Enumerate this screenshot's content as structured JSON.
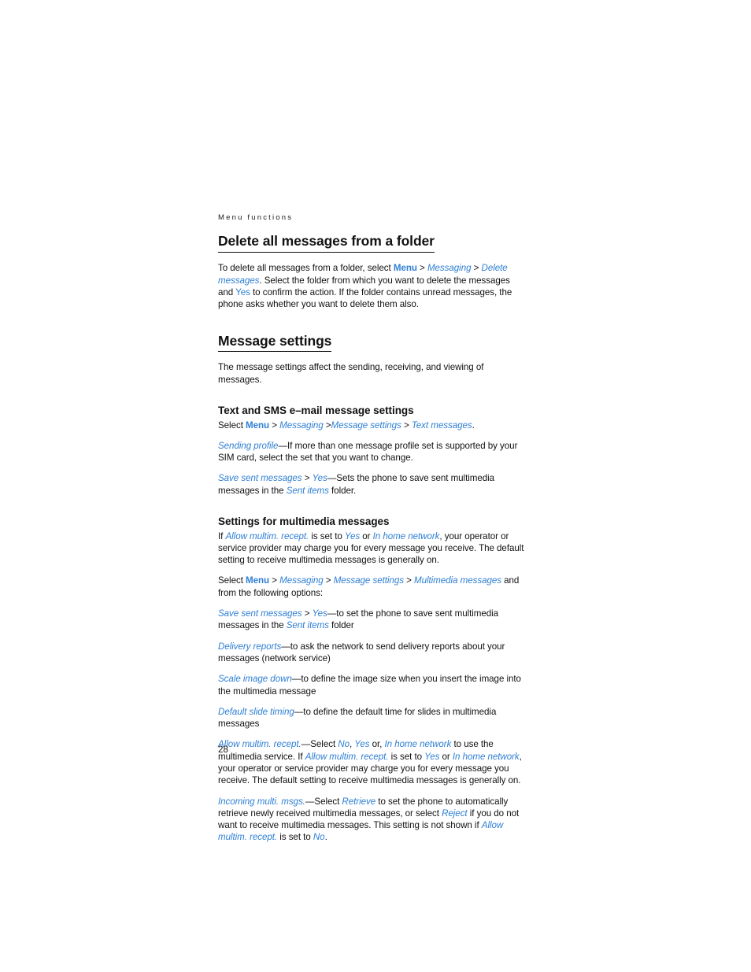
{
  "page": {
    "running_head": "Menu functions",
    "folio": "28",
    "accent_color": "#2e7fd4",
    "text_color": "#111111",
    "background_color": "#ffffff"
  },
  "sections": [
    {
      "id": "delete-all-messages",
      "heading": "Delete all messages from a folder",
      "heading_level": 1,
      "blocks": [
        {
          "id": "delete-all-messages-body",
          "runs": [
            {
              "t": "To delete all messages from a folder, select "
            },
            {
              "t": "Menu",
              "s": "ui-bold"
            },
            {
              "t": " > ",
              "s": "sep"
            },
            {
              "t": "Messaging",
              "s": "ui-italic"
            },
            {
              "t": " > ",
              "s": "sep"
            },
            {
              "t": "Delete messages",
              "s": "ui-italic"
            },
            {
              "t": ". Select the folder from which you want to delete the messages and "
            },
            {
              "t": "Yes",
              "s": "ui-plain"
            },
            {
              "t": " to confirm the action. If the folder contains unread messages, the phone asks whether you want to delete them also."
            }
          ]
        }
      ]
    },
    {
      "id": "message-settings",
      "heading": "Message settings",
      "heading_level": 1,
      "blocks": [
        {
          "id": "message-settings-intro",
          "runs": [
            {
              "t": "The message settings affect the sending, receiving, and viewing of messages."
            }
          ]
        }
      ]
    },
    {
      "id": "text-sms-email-settings",
      "heading": "Text and SMS e–mail message settings",
      "heading_level": 2,
      "blocks": [
        {
          "id": "text-sms-path",
          "runs": [
            {
              "t": "Select "
            },
            {
              "t": "Menu",
              "s": "ui-bold"
            },
            {
              "t": " > ",
              "s": "sep"
            },
            {
              "t": "Messaging",
              "s": "ui-italic"
            },
            {
              "t": " >",
              "s": "sep"
            },
            {
              "t": "Message settings",
              "s": "ui-italic"
            },
            {
              "t": " > ",
              "s": "sep"
            },
            {
              "t": "Text messages",
              "s": "ui-italic"
            },
            {
              "t": "."
            }
          ]
        },
        {
          "id": "sending-profile",
          "runs": [
            {
              "t": "Sending profile",
              "s": "ui-italic"
            },
            {
              "t": "—If more than one message profile set is supported by your SIM card, select the set that you want to change."
            }
          ]
        },
        {
          "id": "save-sent-messages-sms",
          "runs": [
            {
              "t": "Save sent messages",
              "s": "ui-italic"
            },
            {
              "t": " > ",
              "s": "sep"
            },
            {
              "t": "Yes",
              "s": "ui-italic"
            },
            {
              "t": "—Sets the phone to save sent multimedia messages in the "
            },
            {
              "t": "Sent items",
              "s": "ui-italic"
            },
            {
              "t": " folder."
            }
          ]
        }
      ]
    },
    {
      "id": "settings-for-multimedia-messages",
      "heading": "Settings for multimedia messages",
      "heading_level": 2,
      "blocks": [
        {
          "id": "mms-charge-notice",
          "runs": [
            {
              "t": "If "
            },
            {
              "t": "Allow multim. recept.",
              "s": "ui-italic"
            },
            {
              "t": " is set to "
            },
            {
              "t": "Yes",
              "s": "ui-italic"
            },
            {
              "t": " or "
            },
            {
              "t": "In home network",
              "s": "ui-italic"
            },
            {
              "t": ", your operator or service provider may charge you for every message you receive. The default setting to receive multimedia messages is generally on."
            }
          ]
        },
        {
          "id": "mms-path",
          "runs": [
            {
              "t": "Select "
            },
            {
              "t": "Menu",
              "s": "ui-bold"
            },
            {
              "t": " > ",
              "s": "sep"
            },
            {
              "t": "Messaging",
              "s": "ui-italic"
            },
            {
              "t": " > ",
              "s": "sep"
            },
            {
              "t": "Message settings",
              "s": "ui-italic"
            },
            {
              "t": " > ",
              "s": "sep"
            },
            {
              "t": "Multimedia messages",
              "s": "ui-italic"
            },
            {
              "t": " and from the following options:"
            }
          ]
        },
        {
          "id": "save-sent-messages-mms",
          "runs": [
            {
              "t": "Save sent messages",
              "s": "ui-italic"
            },
            {
              "t": " > ",
              "s": "sep"
            },
            {
              "t": "Yes",
              "s": "ui-italic"
            },
            {
              "t": "—to set the phone to save sent multimedia messages in the "
            },
            {
              "t": "Sent items",
              "s": "ui-italic"
            },
            {
              "t": " folder"
            }
          ]
        },
        {
          "id": "delivery-reports",
          "runs": [
            {
              "t": "Delivery reports",
              "s": "ui-italic"
            },
            {
              "t": "—to ask the network to send delivery reports about your messages (network service)"
            }
          ]
        },
        {
          "id": "scale-image-down",
          "runs": [
            {
              "t": "Scale image down",
              "s": "ui-italic"
            },
            {
              "t": "—to define the image size when you insert the image into the multimedia message"
            }
          ]
        },
        {
          "id": "default-slide-timing",
          "runs": [
            {
              "t": "Default slide timing",
              "s": "ui-italic"
            },
            {
              "t": "—to define the default time for slides in multimedia messages"
            }
          ]
        },
        {
          "id": "allow-multim-recept",
          "runs": [
            {
              "t": "Allow multim. recept.",
              "s": "ui-italic"
            },
            {
              "t": "—Select "
            },
            {
              "t": "No",
              "s": "ui-italic"
            },
            {
              "t": ", "
            },
            {
              "t": "Yes",
              "s": "ui-italic"
            },
            {
              "t": " or, "
            },
            {
              "t": "In home network",
              "s": "ui-italic"
            },
            {
              "t": " to use the multimedia service. If "
            },
            {
              "t": "Allow multim. recept.",
              "s": "ui-italic"
            },
            {
              "t": " is set to "
            },
            {
              "t": "Yes",
              "s": "ui-italic"
            },
            {
              "t": " or "
            },
            {
              "t": "In home network",
              "s": "ui-italic"
            },
            {
              "t": ", your operator or service provider may charge you for every message you receive. The default setting to receive multimedia messages is generally on."
            }
          ]
        },
        {
          "id": "incoming-multi-msgs",
          "runs": [
            {
              "t": "Incoming multi. msgs.",
              "s": "ui-italic"
            },
            {
              "t": "—Select "
            },
            {
              "t": "Retrieve",
              "s": "ui-italic"
            },
            {
              "t": " to set the phone to automatically retrieve newly received multimedia messages, or select "
            },
            {
              "t": "Reject",
              "s": "ui-italic"
            },
            {
              "t": " if you do not want to receive multimedia messages. This setting is not shown if "
            },
            {
              "t": "Allow multim. recept.",
              "s": "ui-italic"
            },
            {
              "t": " is set to "
            },
            {
              "t": "No",
              "s": "ui-italic"
            },
            {
              "t": "."
            }
          ]
        }
      ]
    }
  ]
}
